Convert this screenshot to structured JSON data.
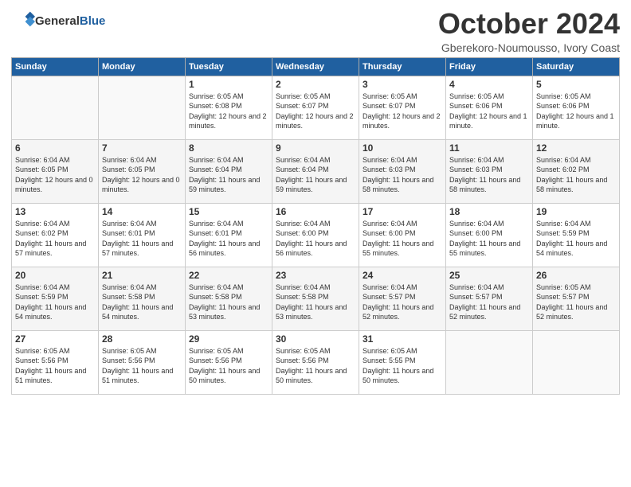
{
  "header": {
    "logo_general": "General",
    "logo_blue": "Blue",
    "month_title": "October 2024",
    "subtitle": "Gberekoro-Noumousso, Ivory Coast"
  },
  "weekdays": [
    "Sunday",
    "Monday",
    "Tuesday",
    "Wednesday",
    "Thursday",
    "Friday",
    "Saturday"
  ],
  "weeks": [
    [
      {
        "day": "",
        "info": ""
      },
      {
        "day": "",
        "info": ""
      },
      {
        "day": "1",
        "info": "Sunrise: 6:05 AM\nSunset: 6:08 PM\nDaylight: 12 hours and 2 minutes."
      },
      {
        "day": "2",
        "info": "Sunrise: 6:05 AM\nSunset: 6:07 PM\nDaylight: 12 hours and 2 minutes."
      },
      {
        "day": "3",
        "info": "Sunrise: 6:05 AM\nSunset: 6:07 PM\nDaylight: 12 hours and 2 minutes."
      },
      {
        "day": "4",
        "info": "Sunrise: 6:05 AM\nSunset: 6:06 PM\nDaylight: 12 hours and 1 minute."
      },
      {
        "day": "5",
        "info": "Sunrise: 6:05 AM\nSunset: 6:06 PM\nDaylight: 12 hours and 1 minute."
      }
    ],
    [
      {
        "day": "6",
        "info": "Sunrise: 6:04 AM\nSunset: 6:05 PM\nDaylight: 12 hours and 0 minutes."
      },
      {
        "day": "7",
        "info": "Sunrise: 6:04 AM\nSunset: 6:05 PM\nDaylight: 12 hours and 0 minutes."
      },
      {
        "day": "8",
        "info": "Sunrise: 6:04 AM\nSunset: 6:04 PM\nDaylight: 11 hours and 59 minutes."
      },
      {
        "day": "9",
        "info": "Sunrise: 6:04 AM\nSunset: 6:04 PM\nDaylight: 11 hours and 59 minutes."
      },
      {
        "day": "10",
        "info": "Sunrise: 6:04 AM\nSunset: 6:03 PM\nDaylight: 11 hours and 58 minutes."
      },
      {
        "day": "11",
        "info": "Sunrise: 6:04 AM\nSunset: 6:03 PM\nDaylight: 11 hours and 58 minutes."
      },
      {
        "day": "12",
        "info": "Sunrise: 6:04 AM\nSunset: 6:02 PM\nDaylight: 11 hours and 58 minutes."
      }
    ],
    [
      {
        "day": "13",
        "info": "Sunrise: 6:04 AM\nSunset: 6:02 PM\nDaylight: 11 hours and 57 minutes."
      },
      {
        "day": "14",
        "info": "Sunrise: 6:04 AM\nSunset: 6:01 PM\nDaylight: 11 hours and 57 minutes."
      },
      {
        "day": "15",
        "info": "Sunrise: 6:04 AM\nSunset: 6:01 PM\nDaylight: 11 hours and 56 minutes."
      },
      {
        "day": "16",
        "info": "Sunrise: 6:04 AM\nSunset: 6:00 PM\nDaylight: 11 hours and 56 minutes."
      },
      {
        "day": "17",
        "info": "Sunrise: 6:04 AM\nSunset: 6:00 PM\nDaylight: 11 hours and 55 minutes."
      },
      {
        "day": "18",
        "info": "Sunrise: 6:04 AM\nSunset: 6:00 PM\nDaylight: 11 hours and 55 minutes."
      },
      {
        "day": "19",
        "info": "Sunrise: 6:04 AM\nSunset: 5:59 PM\nDaylight: 11 hours and 54 minutes."
      }
    ],
    [
      {
        "day": "20",
        "info": "Sunrise: 6:04 AM\nSunset: 5:59 PM\nDaylight: 11 hours and 54 minutes."
      },
      {
        "day": "21",
        "info": "Sunrise: 6:04 AM\nSunset: 5:58 PM\nDaylight: 11 hours and 54 minutes."
      },
      {
        "day": "22",
        "info": "Sunrise: 6:04 AM\nSunset: 5:58 PM\nDaylight: 11 hours and 53 minutes."
      },
      {
        "day": "23",
        "info": "Sunrise: 6:04 AM\nSunset: 5:58 PM\nDaylight: 11 hours and 53 minutes."
      },
      {
        "day": "24",
        "info": "Sunrise: 6:04 AM\nSunset: 5:57 PM\nDaylight: 11 hours and 52 minutes."
      },
      {
        "day": "25",
        "info": "Sunrise: 6:04 AM\nSunset: 5:57 PM\nDaylight: 11 hours and 52 minutes."
      },
      {
        "day": "26",
        "info": "Sunrise: 6:05 AM\nSunset: 5:57 PM\nDaylight: 11 hours and 52 minutes."
      }
    ],
    [
      {
        "day": "27",
        "info": "Sunrise: 6:05 AM\nSunset: 5:56 PM\nDaylight: 11 hours and 51 minutes."
      },
      {
        "day": "28",
        "info": "Sunrise: 6:05 AM\nSunset: 5:56 PM\nDaylight: 11 hours and 51 minutes."
      },
      {
        "day": "29",
        "info": "Sunrise: 6:05 AM\nSunset: 5:56 PM\nDaylight: 11 hours and 50 minutes."
      },
      {
        "day": "30",
        "info": "Sunrise: 6:05 AM\nSunset: 5:56 PM\nDaylight: 11 hours and 50 minutes."
      },
      {
        "day": "31",
        "info": "Sunrise: 6:05 AM\nSunset: 5:55 PM\nDaylight: 11 hours and 50 minutes."
      },
      {
        "day": "",
        "info": ""
      },
      {
        "day": "",
        "info": ""
      }
    ]
  ]
}
